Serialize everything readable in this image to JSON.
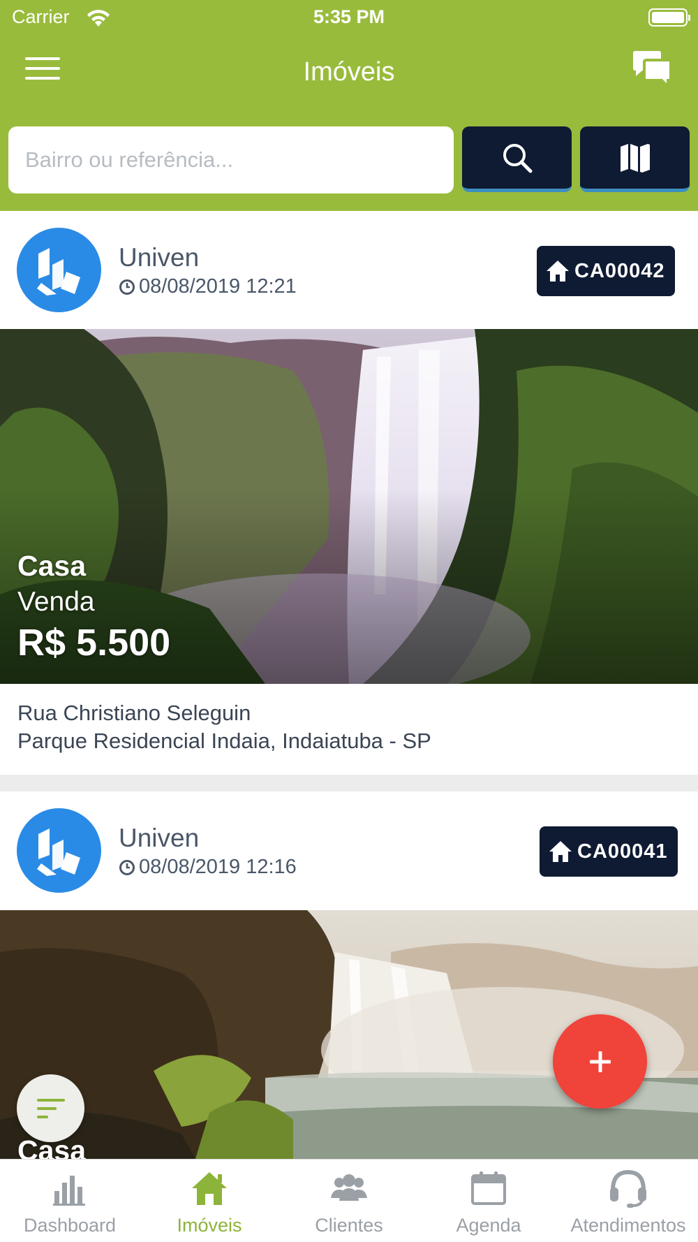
{
  "status_bar": {
    "carrier": "Carrier",
    "time": "5:35 PM"
  },
  "nav": {
    "title": "Imóveis"
  },
  "search": {
    "placeholder": "Bairro ou referência..."
  },
  "listings": [
    {
      "agency": "Univen",
      "datetime": "08/08/2019 12:21",
      "code": "CA00042",
      "type": "Casa",
      "deal": "Venda",
      "price": "R$ 5.500",
      "address_line1": "Rua Christiano Seleguin",
      "address_line2": "Parque Residencial Indaia, Indaiatuba - SP"
    },
    {
      "agency": "Univen",
      "datetime": "08/08/2019 12:16",
      "code": "CA00041",
      "type": "Casa"
    }
  ],
  "tabs": [
    {
      "label": "Dashboard",
      "icon": "bar-chart-icon",
      "active": false
    },
    {
      "label": "Imóveis",
      "icon": "home-icon",
      "active": true
    },
    {
      "label": "Clientes",
      "icon": "users-icon",
      "active": false
    },
    {
      "label": "Agenda",
      "icon": "calendar-icon",
      "active": false
    },
    {
      "label": "Atendimentos",
      "icon": "headset-icon",
      "active": false
    }
  ],
  "colors": {
    "header_green": "#99bb3c",
    "navy": "#0f1a33",
    "logo_blue": "#2a8be6",
    "fab_red": "#f0433a",
    "tab_active": "#8db43a"
  }
}
